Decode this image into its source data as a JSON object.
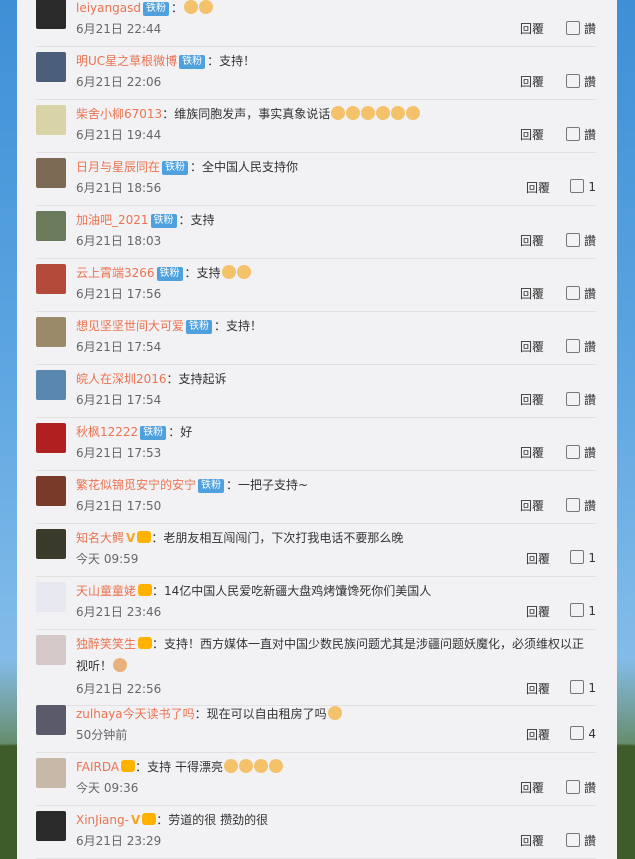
{
  "comments": [
    {
      "user": "leiyangasd",
      "badge": "铁粉",
      "text": "：",
      "emojis": 2,
      "time": "6月21日 22:44",
      "reply": "回覆",
      "like": "讚",
      "avatar": "#2a2a2a"
    },
    {
      "user": "明UC星之草根微博",
      "badge": "铁粉",
      "text": "：支持！",
      "time": "6月21日 22:06",
      "reply": "回覆",
      "like": "讚",
      "avatar": "#4b5e7a"
    },
    {
      "user": "柴舍小柳67013",
      "text": "：维族同胞发声，事实真象说话",
      "emojis": 6,
      "time": "6月21日 19:44",
      "reply": "回覆",
      "like": "讚",
      "avatar": "#d9d3a8"
    },
    {
      "user": "日月与星辰同在",
      "badge": "铁粉",
      "text": "：全中国人民支持你",
      "time": "6月21日 18:56",
      "reply": "回覆",
      "like": "1",
      "avatar": "#7d6a55"
    },
    {
      "user": "加油吧_2021",
      "badge": "铁粉",
      "text": "：支持",
      "time": "6月21日 18:03",
      "reply": "回覆",
      "like": "讚",
      "avatar": "#6b7a5a"
    },
    {
      "user": "云上霄端3266",
      "badge": "铁粉",
      "text": "：支持",
      "emojis": 2,
      "time": "6月21日 17:56",
      "reply": "回覆",
      "like": "讚",
      "avatar": "#b34a3a"
    },
    {
      "user": "想见坚坚世间大可爱",
      "badge": "铁粉",
      "text": "：支持！",
      "time": "6月21日 17:54",
      "reply": "回覆",
      "like": "讚",
      "avatar": "#9a8a6a"
    },
    {
      "user": "皖人在深圳2016",
      "text": "：支持起诉",
      "time": "6月21日 17:54",
      "reply": "回覆",
      "like": "讚",
      "avatar": "#5a87b0"
    },
    {
      "user": "秋枫12222",
      "badge": "铁粉",
      "text": "：好",
      "time": "6月21日 17:53",
      "reply": "回覆",
      "like": "讚",
      "avatar": "#b02020"
    },
    {
      "user": "繁花似锦觅安宁的安宁",
      "badge": "铁粉",
      "text": "：一把子支持~",
      "time": "6月21日 17:50",
      "reply": "回覆",
      "like": "讚",
      "avatar": "#7a3a2a"
    },
    {
      "user": "知名大鳄",
      "vbadge": true,
      "crown": true,
      "text": "：老朋友相互闯闯门，下次打我电话不要那么晚",
      "time": "今天 09:59",
      "reply": "回覆",
      "like": "1",
      "avatar": "#3a3a2a"
    },
    {
      "user": "天山童童姥",
      "crown": true,
      "text": "：14亿中国人民爱吃新疆大盘鸡烤馕馋死你们美国人",
      "time": "6月21日 23:46",
      "reply": "回覆",
      "like": "1",
      "avatar": "#e8e8f0"
    },
    {
      "user": "独醉笑笑生",
      "crown": true,
      "text": "：支持！西方媒体一直对中国少数民族问题尤其是涉疆问题妖魔化，必须维权以正",
      "text2": "视听！",
      "time": "6月21日 22:56",
      "reply": "回覆",
      "like": "1",
      "avatar": "#d4c8c8"
    },
    {
      "user": "zulhaya今天读书了吗",
      "text": "：现在可以自由租房了吗",
      "emojis": 1,
      "time": "50分钟前",
      "reply": "回覆",
      "like": "4",
      "avatar": "#5a5a6a"
    },
    {
      "user": "FAIRDA",
      "crown": true,
      "text": "：支持 干得漂亮",
      "emojis": 4,
      "time": "今天 09:36",
      "reply": "回覆",
      "like": "讚",
      "avatar": "#c8b8a8"
    },
    {
      "user": "XinJiang-",
      "vbadge": true,
      "crown": true,
      "text": "：劳道的很 攒劲的很",
      "time": "6月21日 23:29",
      "reply": "回覆",
      "like": "讚",
      "avatar": "#2a2a2a"
    }
  ]
}
